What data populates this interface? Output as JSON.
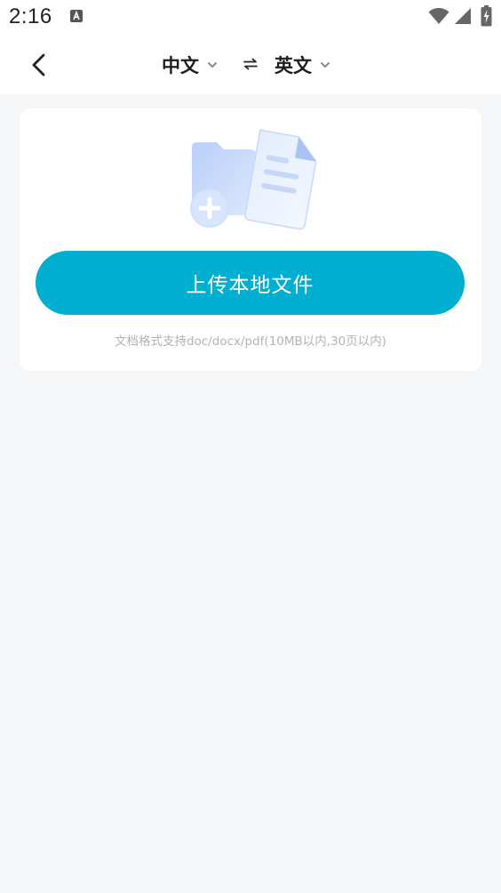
{
  "status_bar": {
    "time": "2:16",
    "icons": [
      "app-notification-icon",
      "wifi-icon",
      "signal-icon",
      "battery-charging-icon"
    ]
  },
  "header": {
    "back_icon": "back-arrow-icon",
    "source_language": "中文",
    "target_language": "英文",
    "swap_icon": "swap-icon",
    "dropdown_icon": "chevron-down-icon"
  },
  "upload_card": {
    "illustration": "folder-document-add-icon",
    "button_label": "上传本地文件",
    "hint": "文档格式支持doc/docx/pdf(10MB以内,30页以内)"
  },
  "colors": {
    "accent": "#00aecf",
    "page_background": "#f5f6f8",
    "card_background": "#ffffff",
    "hint_text": "#b3b3b3",
    "illustration_blue": "#c9dcfb"
  }
}
